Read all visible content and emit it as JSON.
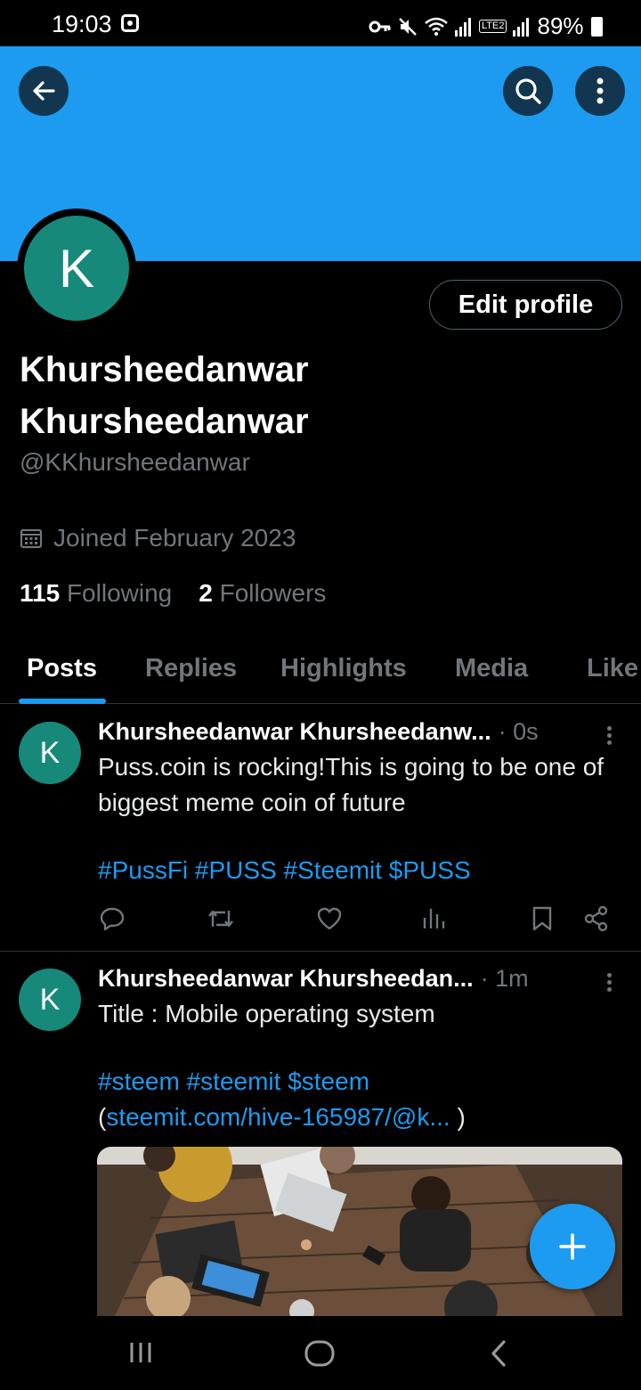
{
  "status_bar": {
    "time": "19:03",
    "network_label": "LTE2",
    "battery": "89%"
  },
  "profile": {
    "avatar_letter": "K",
    "edit_label": "Edit profile",
    "name_line1": "Khursheedanwar",
    "name_line2": "Khursheedanwar",
    "handle": "@KKhursheedanwar",
    "joined": "Joined February 2023",
    "following_count": "115",
    "following_label": "Following",
    "followers_count": "2",
    "followers_label": "Followers"
  },
  "tabs": [
    {
      "label": "Posts",
      "active": true
    },
    {
      "label": "Replies",
      "active": false
    },
    {
      "label": "Highlights",
      "active": false
    },
    {
      "label": "Media",
      "active": false
    },
    {
      "label": "Like",
      "active": false
    }
  ],
  "posts": [
    {
      "avatar_letter": "K",
      "name": "Khursheedanwar Khursheedanw...",
      "time": "· 0s",
      "text": "Puss.coin is rocking!This is going to be one of biggest meme coin of future",
      "hashtags": "#PussFi #PUSS #Steemit $PUSS"
    },
    {
      "avatar_letter": "K",
      "name": "Khursheedanwar Khursheedan...",
      "time": "· 1m",
      "text": "Title : Mobile operating system",
      "hashtags": "#steem #steemit $steem",
      "link_open": "(",
      "link": "steemit.com/hive-165987/@k...",
      "link_close": " )"
    }
  ],
  "colors": {
    "accent": "#1d9bf0",
    "avatar": "#16897b",
    "muted": "#71767b",
    "border": "#2f3336"
  },
  "icons": {
    "back": "arrow-left-icon",
    "search": "search-icon",
    "more": "more-vertical-icon",
    "calendar": "calendar-icon",
    "reply": "reply-icon",
    "repost": "repost-icon",
    "like": "heart-icon",
    "views": "views-icon",
    "bookmark": "bookmark-icon",
    "share": "share-icon",
    "compose": "plus-icon"
  }
}
